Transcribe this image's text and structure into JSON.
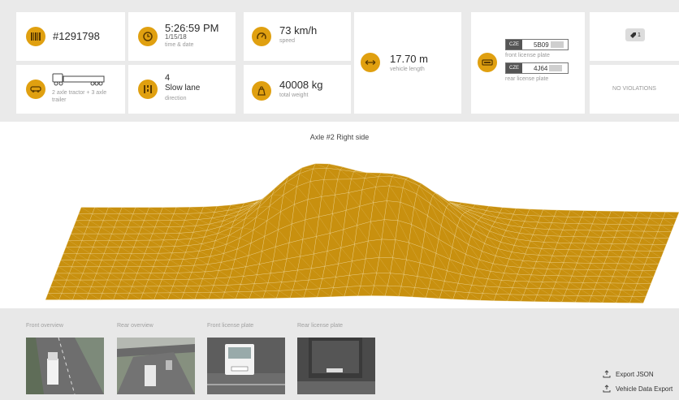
{
  "vehicle": {
    "id": "#1291798",
    "time": "5:26:59 PM",
    "date": "1/15/18",
    "time_label": "time & date",
    "speed": "73 km/h",
    "speed_label": "speed",
    "length": "17.70 m",
    "length_label": "vehicle length",
    "class_desc": "2 axle tractor + 3 axle trailer",
    "lane": "4",
    "lane_name": "Slow lane",
    "lane_label": "direction",
    "weight": "40008 kg",
    "weight_label": "total weight"
  },
  "plates": {
    "front_country": "CZE",
    "front_number": "5B09",
    "front_label": "front license plate",
    "rear_country": "CZE",
    "rear_number": "4J64",
    "rear_label": "rear license plate"
  },
  "violations": {
    "badge_count": "1",
    "status": "NO VIOLATIONS"
  },
  "surface": {
    "title": "Axle #2 Right side",
    "fill_color": "#c8900f",
    "line_color": "#f3dfa8"
  },
  "thumbnails": [
    {
      "label": "Front overview"
    },
    {
      "label": "Rear overview"
    },
    {
      "label": "Front license plate"
    },
    {
      "label": "Rear license plate"
    }
  ],
  "exports": {
    "json": "Export JSON",
    "vehicle_data": "Vehicle Data Export"
  },
  "colors": {
    "accent": "#e0a010",
    "panel": "#eaeaea"
  }
}
